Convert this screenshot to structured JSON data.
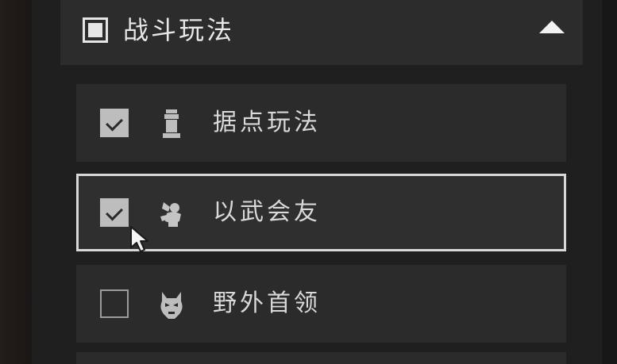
{
  "category": {
    "title": "战斗玩法",
    "checked": true,
    "expanded": true
  },
  "filters": [
    {
      "label": "据点玩法",
      "checked": true,
      "icon": "stronghold-tower-icon"
    },
    {
      "label": "以武会友",
      "checked": true,
      "icon": "martial-duel-icon",
      "hovered": true
    },
    {
      "label": "野外首领",
      "checked": false,
      "icon": "demon-boss-icon"
    }
  ],
  "colors": {
    "panel": "#1f1f1f",
    "row": "#2b2b2b",
    "header": "#2c2c2c",
    "text": "#d9d9d9",
    "selected_border": "#d8d8d8"
  }
}
